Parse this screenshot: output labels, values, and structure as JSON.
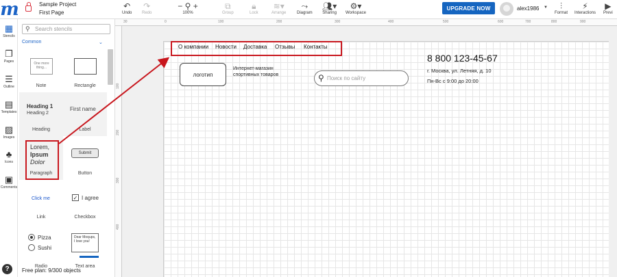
{
  "header": {
    "project_name": "Sample Project",
    "page_name": "First Page",
    "tools": [
      {
        "label": "Undo",
        "icon": "undo-icon"
      },
      {
        "label": "Redo",
        "icon": "redo-icon"
      },
      {
        "label": "100%",
        "icon": "zoom-icon"
      },
      {
        "label": "Group",
        "icon": "group-icon"
      },
      {
        "label": "Lock",
        "icon": "lock-icon"
      },
      {
        "label": "Arrange",
        "icon": "arrange-icon"
      },
      {
        "label": "Diagram",
        "icon": "diagram-icon"
      },
      {
        "label": "Sharing",
        "icon": "sharing-icon"
      },
      {
        "label": "Workspace",
        "icon": "workspace-icon"
      }
    ],
    "upgrade_label": "UPGRADE NOW",
    "username": "alex1986",
    "right_tools": [
      {
        "label": "Format",
        "icon": "format-icon"
      },
      {
        "label": "Interactions",
        "icon": "interactions-icon"
      },
      {
        "label": "Previ",
        "icon": "preview-icon"
      }
    ]
  },
  "rail": {
    "items": [
      {
        "label": "Stencils",
        "icon": "stencils-icon"
      },
      {
        "label": "Pages",
        "icon": "pages-icon"
      },
      {
        "label": "Outline",
        "icon": "outline-icon"
      },
      {
        "label": "Templates",
        "icon": "templates-icon"
      },
      {
        "label": "Images",
        "icon": "images-icon"
      },
      {
        "label": "Icons",
        "icon": "icons-icon"
      },
      {
        "label": "Comments",
        "icon": "comments-icon"
      }
    ],
    "help": "?"
  },
  "stencils": {
    "search_placeholder": "Search stencils",
    "category": "Common",
    "items": [
      {
        "label": "Note",
        "preview": "One more thing..."
      },
      {
        "label": "Rectangle"
      },
      {
        "label": "Heading",
        "preview": [
          "Heading 1",
          "Heading 2"
        ]
      },
      {
        "label": "Label",
        "preview": "First name"
      },
      {
        "label": "Paragraph",
        "preview": [
          "Lorem,",
          "Ipsum",
          "Dolor"
        ]
      },
      {
        "label": "Button",
        "preview": "Submit"
      },
      {
        "label": "Link",
        "preview": "Click me"
      },
      {
        "label": "Checkbox",
        "preview": "I agree"
      },
      {
        "label": "Radio",
        "preview": [
          "Pizza",
          "Sushi"
        ]
      },
      {
        "label": "Text area",
        "preview": [
          "Dear Moqups,",
          "I love you!"
        ]
      }
    ],
    "free_plan": "Free plan: 9/300 objects"
  },
  "ruler": {
    "h": [
      "30",
      "0",
      "100",
      "200",
      "300",
      "400",
      "500",
      "600",
      "700",
      "800",
      "900"
    ],
    "v": [
      "100",
      "200",
      "300",
      "400"
    ]
  },
  "mockup": {
    "nav": [
      "О компании",
      "Новости",
      "Доставка",
      "Отзывы",
      "Контакты"
    ],
    "logo": "логотип",
    "shop_line1": "Интернет-магазин",
    "shop_line2": "спортивных товаров",
    "search_placeholder": "Поиск по сайту",
    "phone": "8 800 123-45-67",
    "address": "г. Москва, ул. Летняя, д. 10",
    "hours": "Пн-Вс с 9:00 до 20:00"
  },
  "colors": {
    "brand": "#1b63c6",
    "upgrade": "#1565c0",
    "highlight": "#c8161d"
  }
}
